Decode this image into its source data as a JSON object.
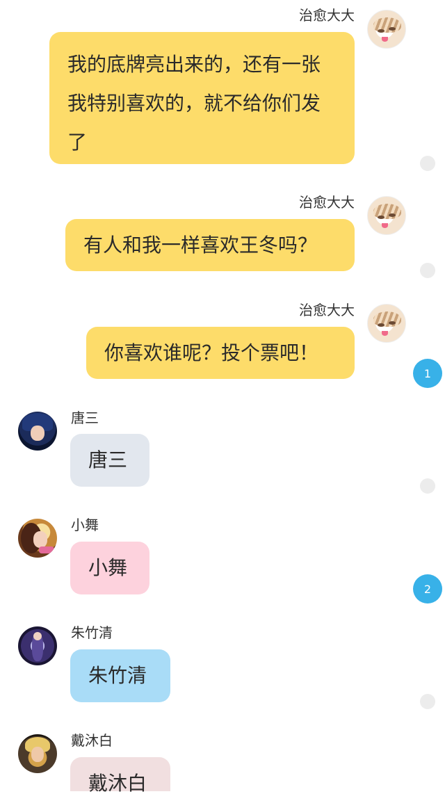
{
  "colors": {
    "self_bubble": "#fddc6a",
    "badge": "#38b1e8"
  },
  "messages": [
    {
      "sender": "治愈大大",
      "side": "right",
      "text": "我的底牌亮出来的，还有一张我特别喜欢的，就不给你们发了",
      "avatar": "cat-avatar"
    },
    {
      "sender": "治愈大大",
      "side": "right",
      "text": "有人和我一样喜欢王冬吗？",
      "avatar": "cat-avatar"
    },
    {
      "sender": "治愈大大",
      "side": "right",
      "text": "你喜欢谁呢？投个票吧！",
      "avatar": "cat-avatar",
      "badge": "1"
    },
    {
      "sender": "唐三",
      "side": "left",
      "text": "唐三",
      "avatar": "tang-san-avatar"
    },
    {
      "sender": "小舞",
      "side": "left",
      "text": "小舞",
      "avatar": "xiao-wu-avatar",
      "badge": "2"
    },
    {
      "sender": "朱竹清",
      "side": "left",
      "text": "朱竹清",
      "avatar": "zhu-zhuqing-avatar"
    },
    {
      "sender": "戴沐白",
      "side": "left",
      "text": "戴沐白",
      "avatar": "dai-mubai-avatar"
    }
  ]
}
